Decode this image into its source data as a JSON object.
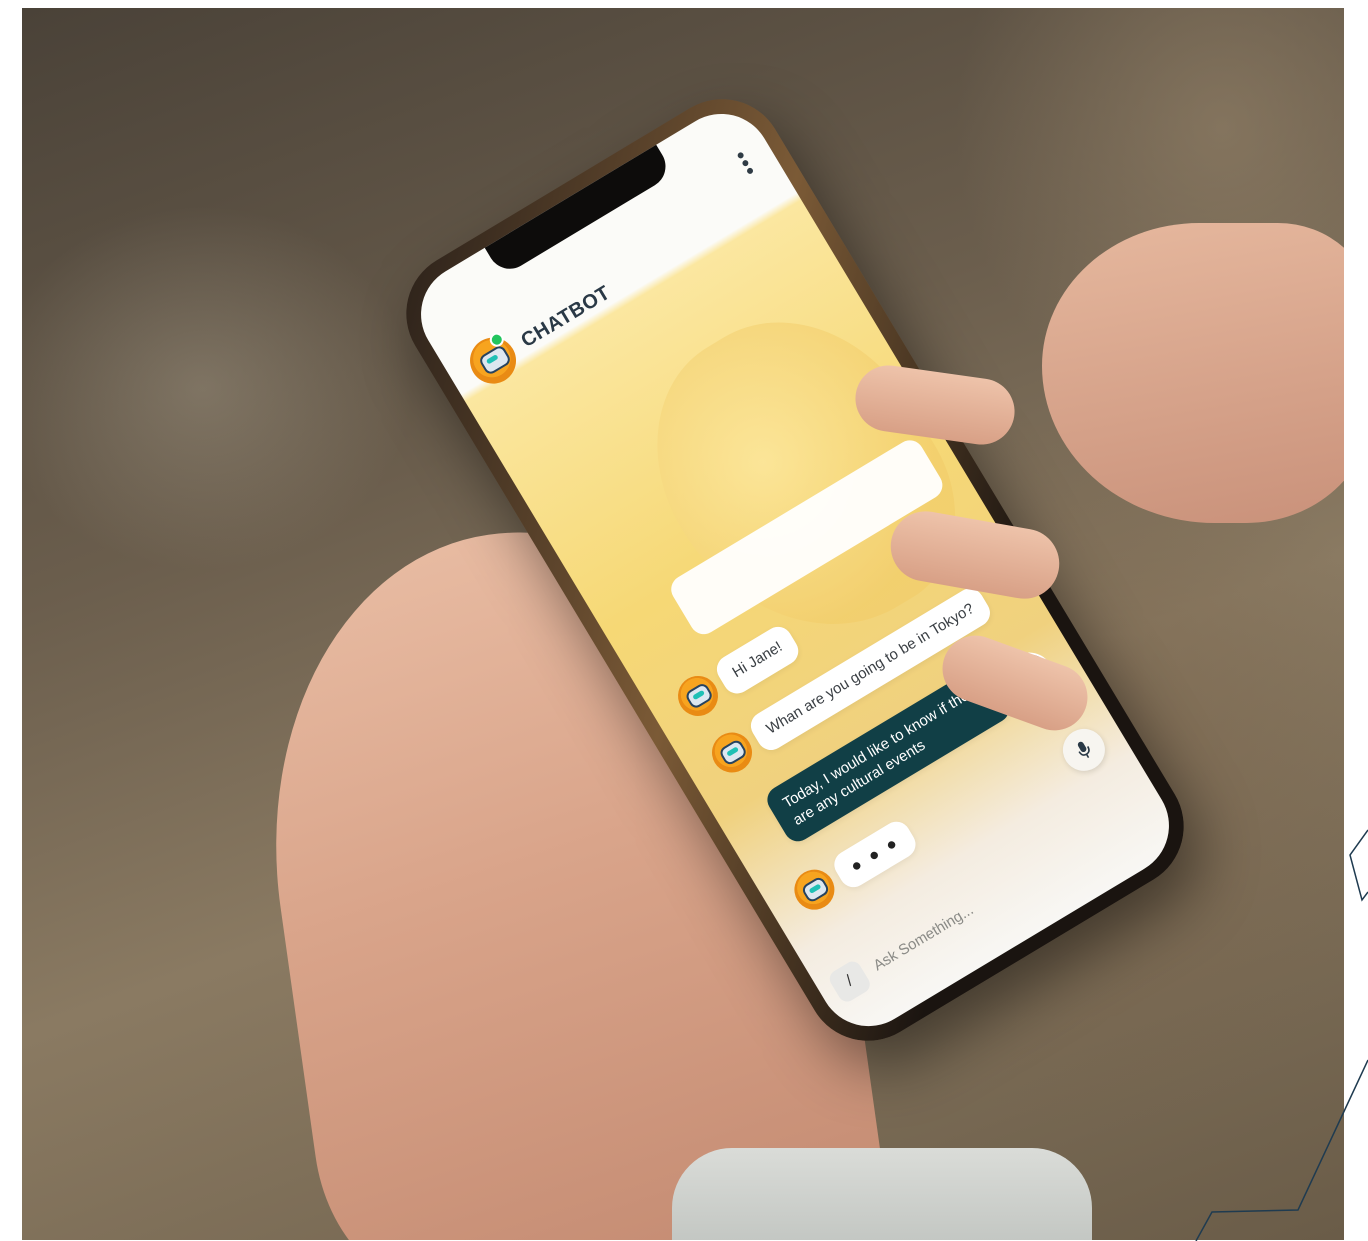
{
  "app": {
    "title": "CHATBOT",
    "status_color": "#22c55e",
    "accent": "#f7a41f",
    "user_bubble_color": "#113f46"
  },
  "menu_icon": "more-vertical-icon",
  "messages": [
    {
      "sender": "bot",
      "text": "Hi Jane!"
    },
    {
      "sender": "bot",
      "text": "Whan are you going to be in Tokyo?"
    },
    {
      "sender": "user",
      "text": "Today, I would like to know if there are any cultural events"
    },
    {
      "sender": "bot",
      "text": "• • •"
    }
  ],
  "input": {
    "placeholder": "Ask Something...",
    "attach_icon": "slash-icon",
    "mic_icon": "microphone-icon"
  }
}
